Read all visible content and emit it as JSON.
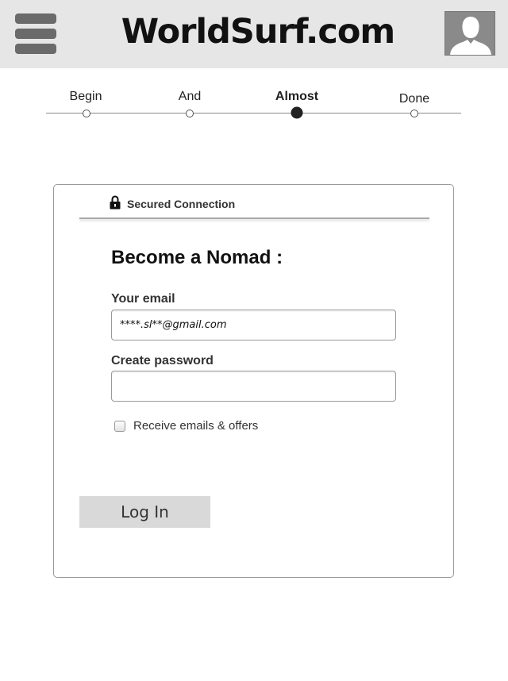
{
  "header": {
    "site_title": "WorldSurf.com",
    "menu_icon": "hamburger-menu-icon",
    "avatar_icon": "user-avatar-icon",
    "colors": {
      "background": "#e6e6e6",
      "icon": "#6a6a6a",
      "avatar": "#8a8a8a"
    }
  },
  "progress": {
    "steps": [
      {
        "label": "Begin",
        "state": "complete"
      },
      {
        "label": "And",
        "state": "complete"
      },
      {
        "label": "Almost",
        "state": "current"
      },
      {
        "label": "Done",
        "state": "upcoming"
      }
    ]
  },
  "form": {
    "secure_icon": "lock-icon",
    "secure_label": "Secured Connection",
    "title": "Become a Nomad :",
    "email_label": "Your email",
    "email_value": "****.sl**@gmail.com",
    "password_label": "Create password",
    "password_value": "",
    "checkbox_label": "Receive emails & offers",
    "checkbox_checked": false,
    "submit_label": "Log In"
  }
}
